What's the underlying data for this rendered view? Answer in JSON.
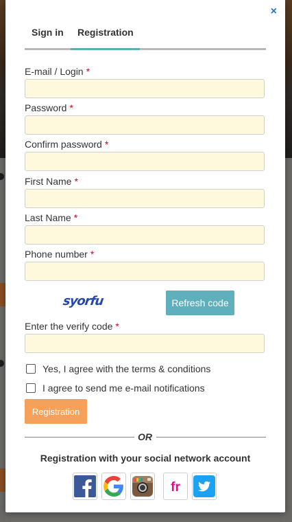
{
  "modal": {
    "close_symbol": "×",
    "tabs": [
      {
        "label": "Sign in",
        "active": false
      },
      {
        "label": "Registration",
        "active": true
      }
    ]
  },
  "form": {
    "fields": [
      {
        "label": "E-mail / Login",
        "required": "*",
        "value": ""
      },
      {
        "label": "Password",
        "required": "*",
        "value": ""
      },
      {
        "label": "Confirm password",
        "required": "*",
        "value": ""
      },
      {
        "label": "First Name",
        "required": "*",
        "value": ""
      },
      {
        "label": "Last Name",
        "required": "*",
        "value": ""
      },
      {
        "label": "Phone number",
        "required": "*",
        "value": ""
      }
    ],
    "captcha_text": "syorfu",
    "refresh_label": "Refresh code",
    "verify": {
      "label": "Enter the verify code",
      "required": "*",
      "value": ""
    },
    "checkboxes": [
      {
        "label": "Yes, I agree with the terms & conditions",
        "checked": false
      },
      {
        "label": "I agree to send me e-mail notifications",
        "checked": false
      }
    ],
    "submit_label": "Registration"
  },
  "social": {
    "or_text": "OR",
    "title": "Registration with your social network account",
    "providers": [
      {
        "name": "facebook-icon",
        "color": "#3b5998"
      },
      {
        "name": "google-icon",
        "color": "#4285f4"
      },
      {
        "name": "instagram-icon",
        "color": "#8a6a4f"
      },
      {
        "name": "flickr-icon",
        "color": "#ff0084"
      },
      {
        "name": "twitter-icon",
        "color": "#1da1f2"
      }
    ]
  },
  "colors": {
    "accent_tab": "#5aaeb8",
    "refresh_button": "#5fafbd",
    "submit_button": "#f6a15b",
    "input_bg": "#fef9dc",
    "required": "#d0021b",
    "close": "#2a6fc9"
  }
}
